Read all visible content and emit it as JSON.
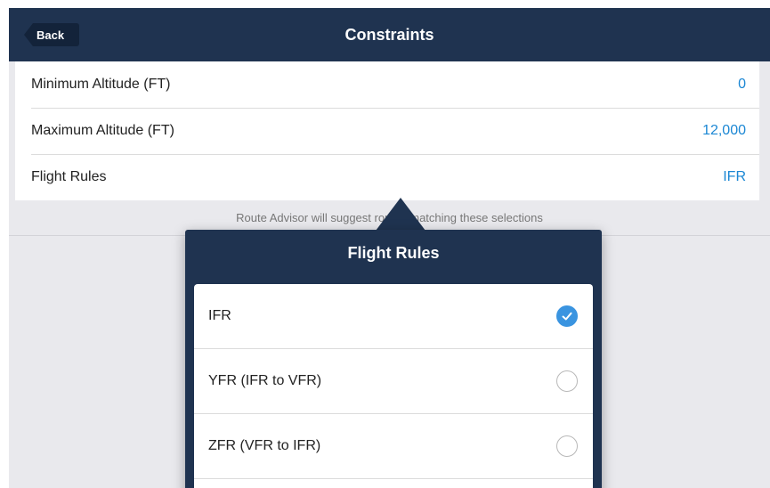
{
  "navbar": {
    "back_label": "Back",
    "title": "Constraints"
  },
  "settings": [
    {
      "label": "Minimum Altitude (FT)",
      "value": "0"
    },
    {
      "label": "Maximum Altitude (FT)",
      "value": "12,000"
    },
    {
      "label": "Flight Rules",
      "value": "IFR"
    }
  ],
  "helper_text": "Route Advisor will suggest routes matching these selections",
  "popover": {
    "title": "Flight Rules",
    "options": [
      {
        "label": "IFR",
        "selected": true
      },
      {
        "label": "YFR (IFR to VFR)",
        "selected": false
      },
      {
        "label": "ZFR (VFR to IFR)",
        "selected": false
      }
    ]
  },
  "colors": {
    "navbar": "#1f3350",
    "accent": "#1b87d4",
    "check": "#3a94e0"
  }
}
